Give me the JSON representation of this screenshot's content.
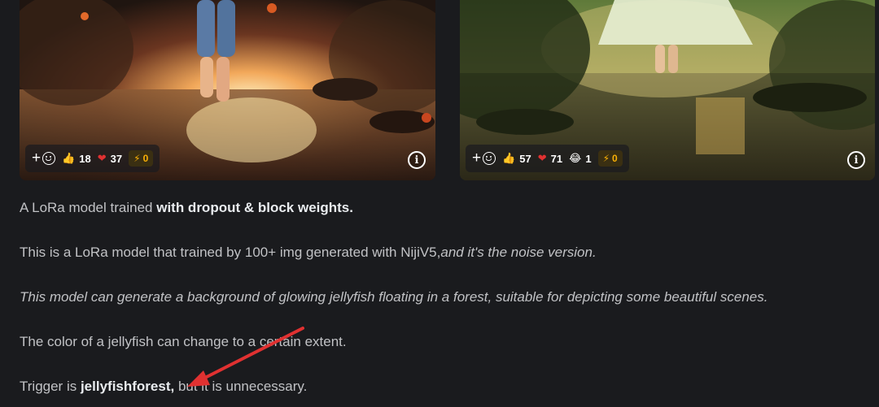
{
  "cards": [
    {
      "reactions": {
        "add": "+",
        "like": "18",
        "heart": "37",
        "bolt": "0"
      }
    },
    {
      "reactions": {
        "add": "+",
        "like": "57",
        "heart": "71",
        "laugh": "1",
        "bolt": "0"
      }
    }
  ],
  "description": {
    "p1": {
      "text": "A LoRa model trained ",
      "bold": "with dropout & block weights."
    },
    "p2": {
      "text": "This is a LoRa model that trained by 100+ img generated with NijiV5,",
      "italic": "and it's the noise version."
    },
    "p3": {
      "italic": "This model can generate a background of glowing jellyfish floating in a forest, suitable for depicting some beautiful scenes."
    },
    "p4": {
      "text": "The color of a jellyfish can change to a certain extent."
    },
    "p5": {
      "text": "Trigger is ",
      "bold": "jellyfishforest,",
      "tail": " but it is unnecessary."
    }
  },
  "colors": {
    "background": "#1a1b1e",
    "text": "#c1c2c5",
    "bolt_badge": "#fab005",
    "heart": "#e03131",
    "annotation_arrow": "#e03131"
  },
  "icons": [
    "add-reaction-icon",
    "thumbs-up-icon",
    "heart-icon",
    "laugh-icon",
    "lightning-icon",
    "info-icon"
  ]
}
